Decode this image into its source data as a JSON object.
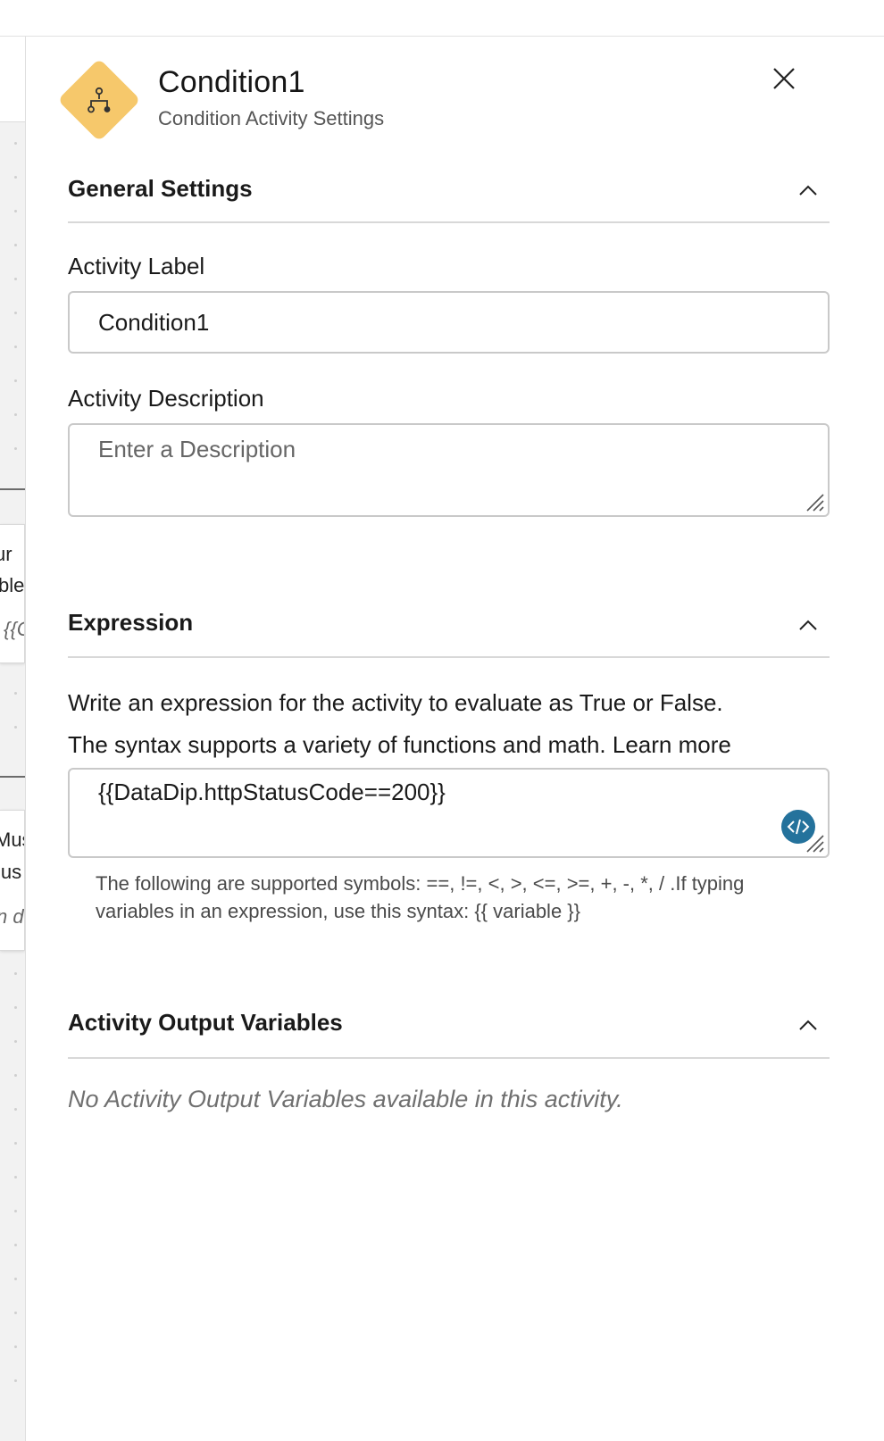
{
  "panel": {
    "title": "Condition1",
    "subtitle": "Condition Activity Settings",
    "icon": "flow-branch-icon",
    "icon_color": "#f6c86b",
    "close_icon": "close-icon"
  },
  "general_settings": {
    "title": "General Settings",
    "activity_label": {
      "label": "Activity Label",
      "value": "Condition1"
    },
    "activity_description": {
      "label": "Activity Description",
      "placeholder": "Enter a Description",
      "value": ""
    }
  },
  "expression": {
    "title": "Expression",
    "description_line1": "Write an expression for the activity to evaluate as True or False.",
    "description_line2": "The syntax supports a variety of functions and math.",
    "learn_more": "Learn more",
    "value": "{{DataDip.httpStatusCode==200}}",
    "code_button_icon": "code-icon",
    "code_button_color": "#24729c",
    "help_line1": "The following are supported symbols: ==, !=, <, >, <=, >=, +, -, *, / .If typing",
    "help_line2": "variables in an expression, use this syntax: {{ variable }}"
  },
  "output_variables": {
    "title": "Activity Output Variables",
    "empty_message": "No Activity Output Variables available in this activity."
  },
  "canvas_fragments": {
    "card1_line1": "ur",
    "card1_line2": "ble",
    "card1_line3": "{{C",
    "card2_line1": "Mus",
    "card2_line2": "lus",
    "card2_line3": "n d"
  }
}
